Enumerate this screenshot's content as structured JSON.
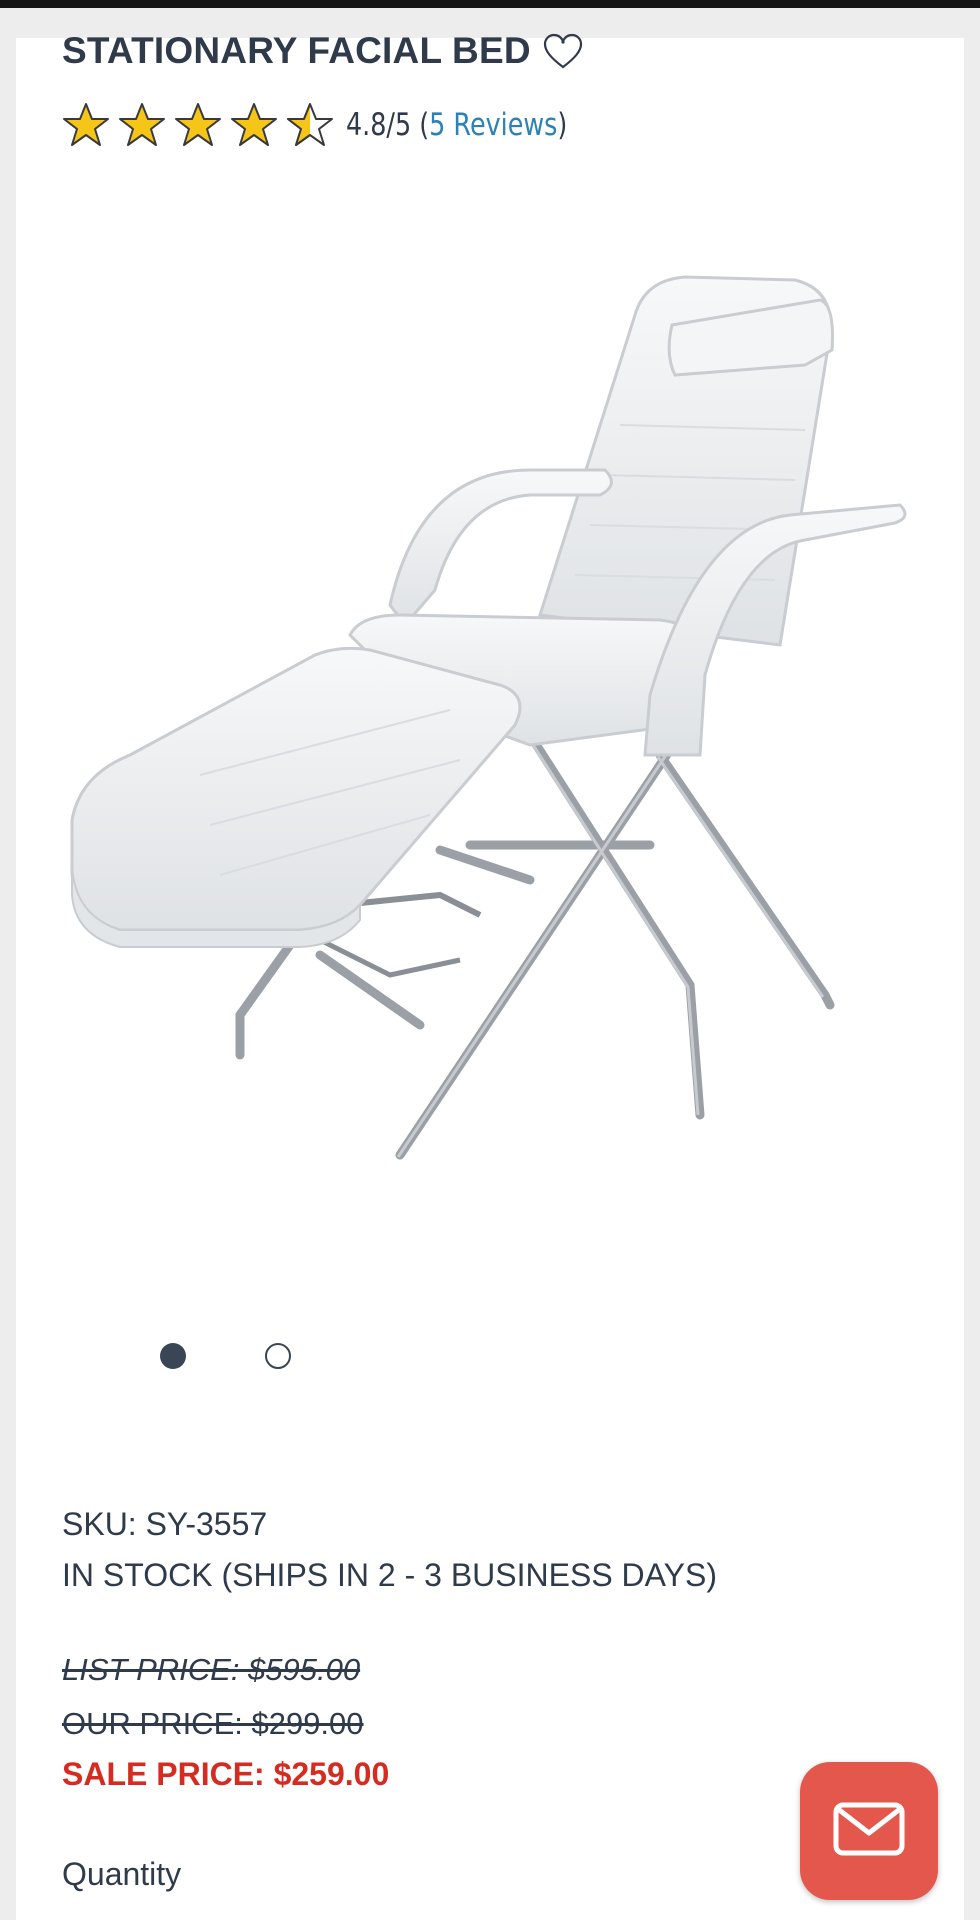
{
  "product": {
    "title": "STATIONARY FACIAL BED",
    "rating": 4.8,
    "rating_text": "4.8/5",
    "reviews_open": "(",
    "reviews_link": "5 Reviews",
    "reviews_close": ")",
    "stars": [
      1,
      1,
      1,
      1,
      0.5
    ],
    "sku": "SKU: SY-3557",
    "stock": "IN STOCK (SHIPS IN 2 - 3 BUSINESS DAYS)",
    "list_price": "LIST PRICE: $595.00",
    "our_price": "OUR PRICE: $299.00",
    "sale_price": "SALE PRICE: $259.00",
    "quantity_label": "Quantity"
  },
  "carousel": {
    "active_index": 0,
    "count": 2
  },
  "icons": {
    "favorite": "heart-icon",
    "chat": "envelope-icon",
    "star": "star-icon"
  },
  "colors": {
    "text": "#2f3a4a",
    "link": "#2c82b7",
    "sale": "#d62b20",
    "star": "#f5c518",
    "chat_button": "#e4574c"
  }
}
